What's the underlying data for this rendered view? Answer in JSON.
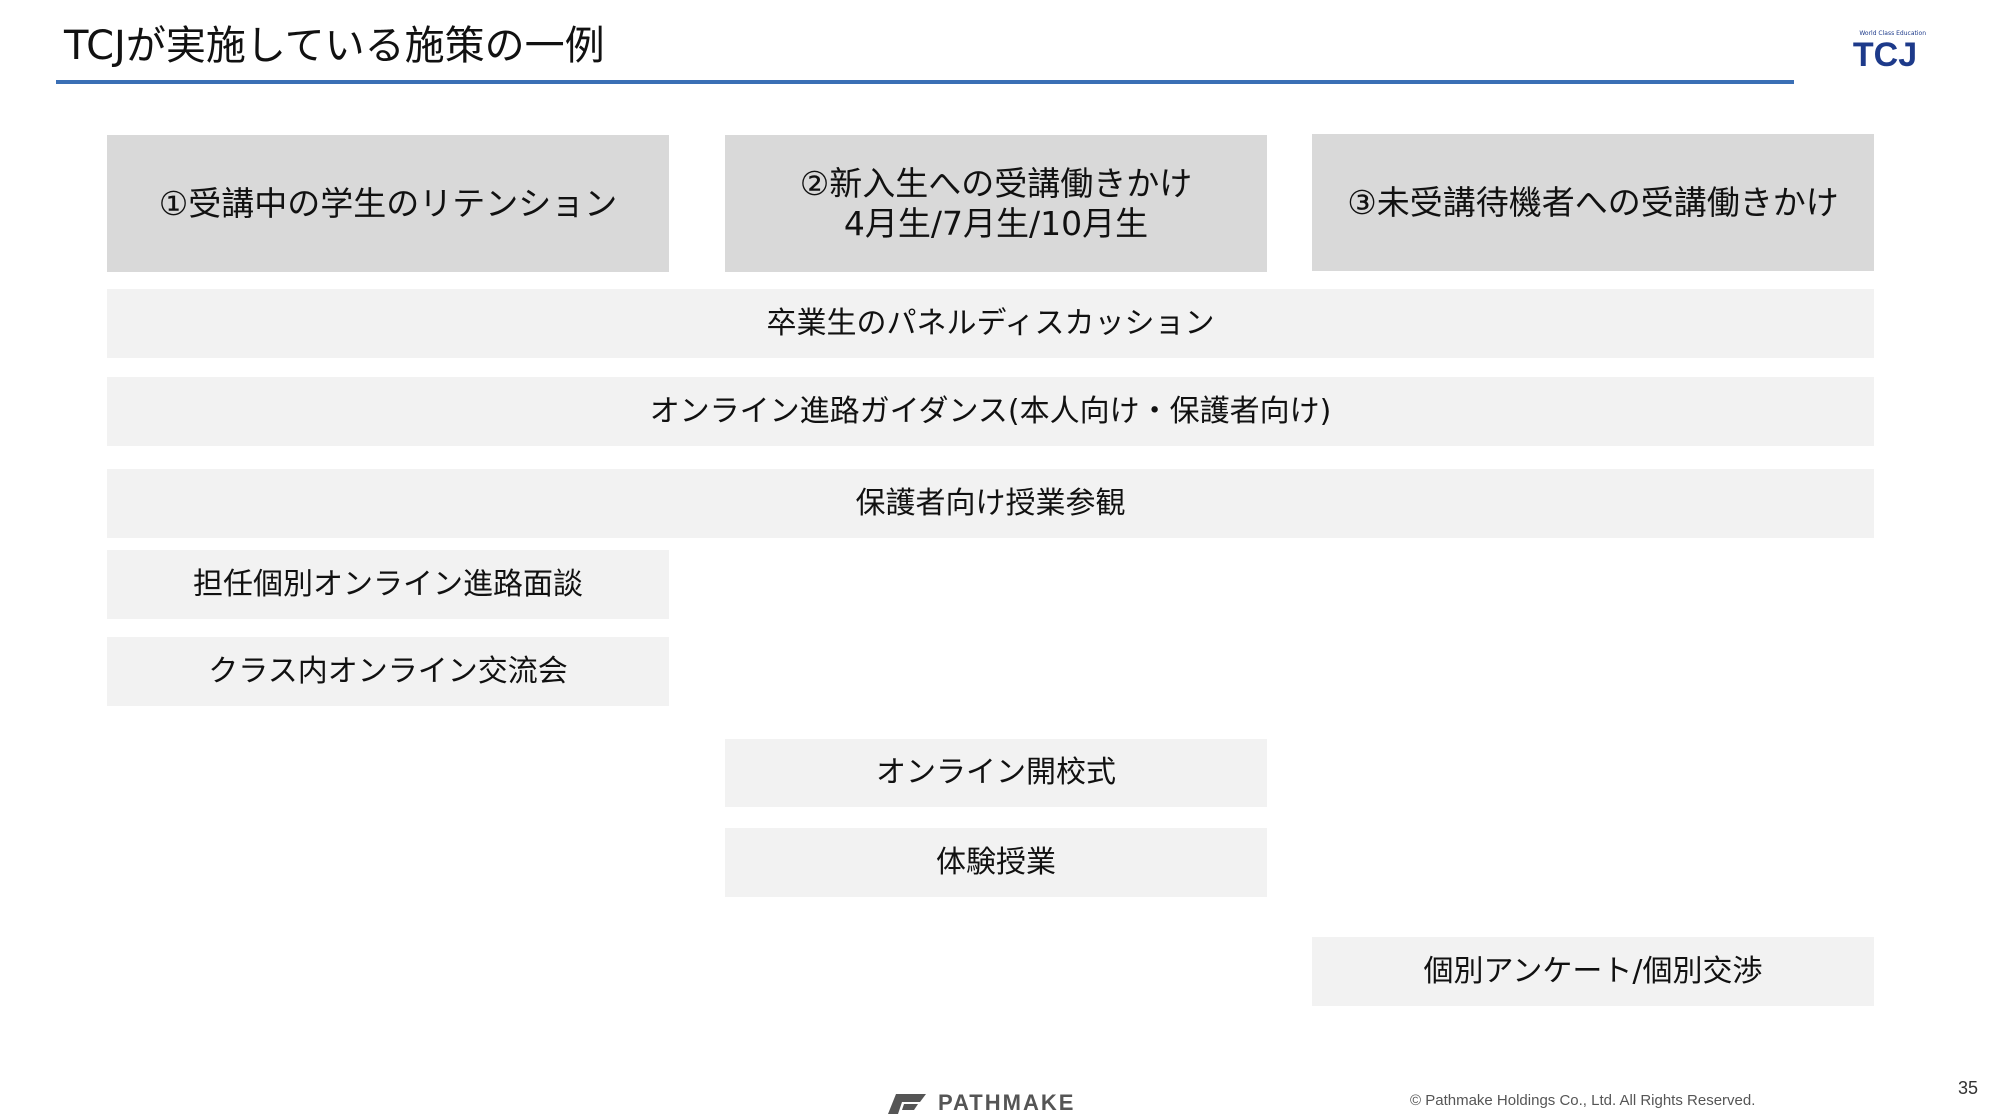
{
  "slide": {
    "title": "TCJが実施している施策の一例",
    "page_number": "35"
  },
  "logo": {
    "tagline": "World Class Education",
    "text": "TCJ",
    "color": "#1d3a8a"
  },
  "columns": [
    {
      "line1": "①受講中の学生のリテンション",
      "line2": ""
    },
    {
      "line1": "②新入生への受講働きかけ",
      "line2": "4月生/7月生/10月生"
    },
    {
      "line1": "③未受講待機者への受講働きかけ",
      "line2": ""
    }
  ],
  "measures": [
    "卒業生のパネルディスカッション",
    "オンライン進路ガイダンス(本人向け・保護者向け)",
    "保護者向け授業参観",
    "担任個別オンライン進路面談",
    "クラス内オンライン交流会",
    "オンライン開校式",
    "体験授業",
    "個別アンケート/個別交渉"
  ],
  "footer": {
    "brand": "PATHMAKE",
    "copyright": "© Pathmake Holdings Co., Ltd.  All Rights Reserved."
  },
  "colors": {
    "title_rule": "#3a6fb5",
    "header_box": "#d9d9d9",
    "row_box": "#f2f2f2"
  }
}
